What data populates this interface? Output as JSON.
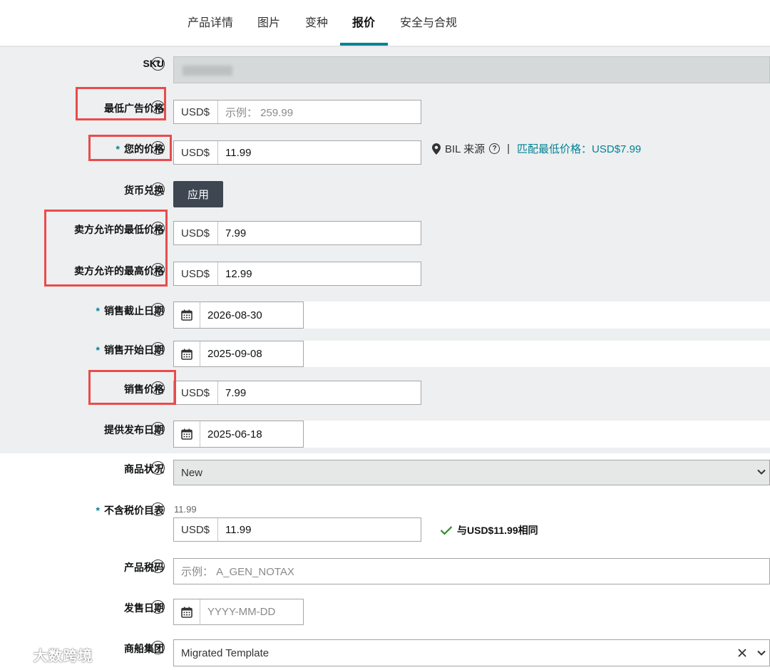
{
  "tabs": [
    "产品详情",
    "图片",
    "变种",
    "报价",
    "安全与合规"
  ],
  "active_tab": "报价",
  "help_glyph": "?",
  "required_mark": "*",
  "fields": {
    "sku": {
      "label": "SKU"
    },
    "min_ad_price": {
      "label": "最低广告价格",
      "prefix": "USD$",
      "placeholder": "示例： 259.99"
    },
    "your_price": {
      "label": "您的价格",
      "prefix": "USD$",
      "value": "11.99"
    },
    "currency": {
      "label": "货币兑换",
      "button": "应用"
    },
    "seller_min": {
      "label": "卖方允许的最低价格",
      "prefix": "USD$",
      "value": "7.99"
    },
    "seller_max": {
      "label": "卖方允许的最高价格",
      "prefix": "USD$",
      "value": "12.99"
    },
    "sale_end": {
      "label": "销售截止日期",
      "value": "2026-08-30"
    },
    "sale_start": {
      "label": "销售开始日期",
      "value": "2025-09-08"
    },
    "sale_price": {
      "label": "销售价格",
      "prefix": "USD$",
      "value": "7.99"
    },
    "offer_release": {
      "label": "提供发布日期",
      "value": "2025-06-18"
    },
    "condition": {
      "label": "商品状况",
      "value": "New"
    },
    "list_price": {
      "label": "不含税价目表",
      "above": "11.99",
      "prefix": "USD$",
      "value": "11.99",
      "ok_text": "与USD$11.99相同"
    },
    "tax_code": {
      "label": "产品税码",
      "placeholder": "示例： A_GEN_NOTAX"
    },
    "release_date": {
      "label": "发售日期",
      "placeholder": "YYYY-MM-DD"
    },
    "shipping_group": {
      "label": "商船集团",
      "value": "Migrated Template"
    }
  },
  "bil": {
    "pin": "BIL 来源",
    "sep": "|",
    "match": "匹配最低价格：USD$7.99"
  },
  "watermark": "大数跨境",
  "colors": {
    "accent": "#008296",
    "highlight": "#e84c4c",
    "button": "#3e4651",
    "ok": "#2e8b2e"
  }
}
